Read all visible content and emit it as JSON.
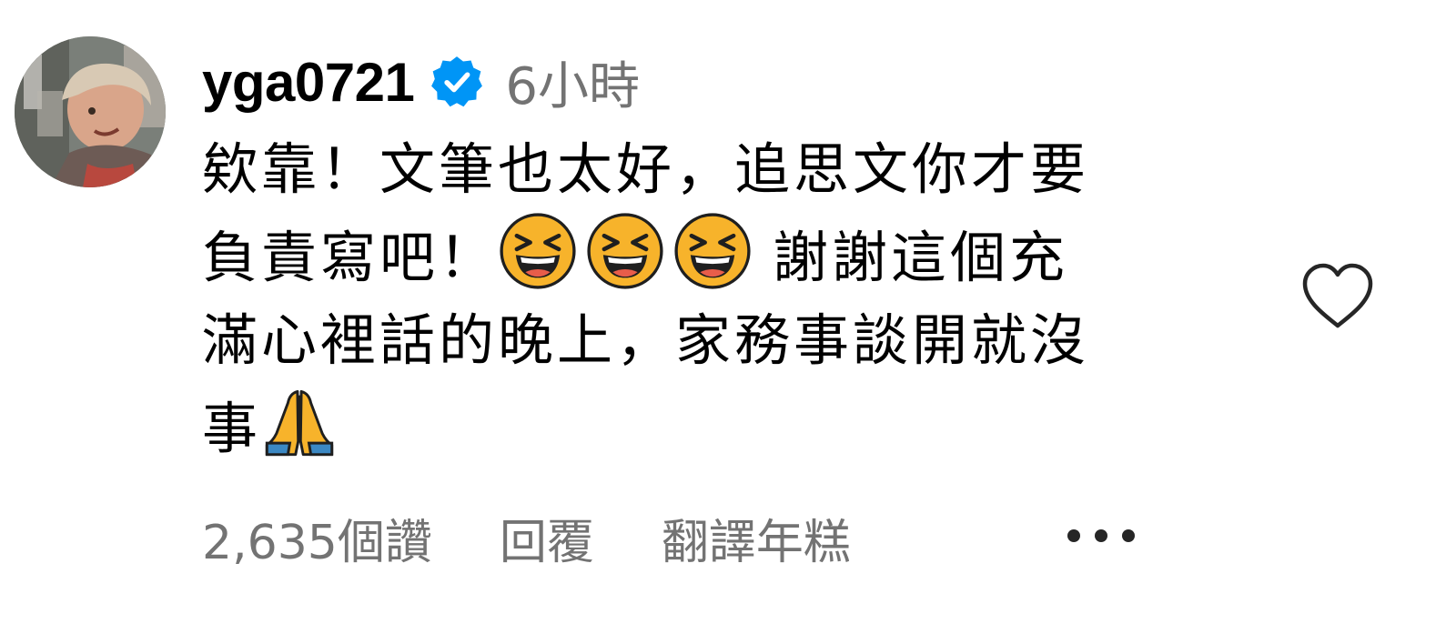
{
  "comment": {
    "username": "yga0721",
    "verified": true,
    "timestamp": "6小時",
    "text_lines": [
      "欸靠！文筆也太好，追思文你才要",
      "負責寫吧！",
      "謝謝這個充",
      "滿心裡話的晚上，家務事談開就沒",
      "事"
    ],
    "emojis": {
      "laughing": "grinning-squinting-face",
      "hands": "folded-hands"
    },
    "likes_label": "2,635個讚",
    "reply_label": "回覆",
    "translate_label": "翻譯年糕",
    "more_icon": "more-options-icon",
    "heart_icon": "heart-outline-icon"
  },
  "colors": {
    "text": "#000000",
    "secondary": "#737373",
    "verified_blue": "#0095f6",
    "emoji_yellow": "#f7b32b",
    "hands_blue": "#3b88c3"
  }
}
